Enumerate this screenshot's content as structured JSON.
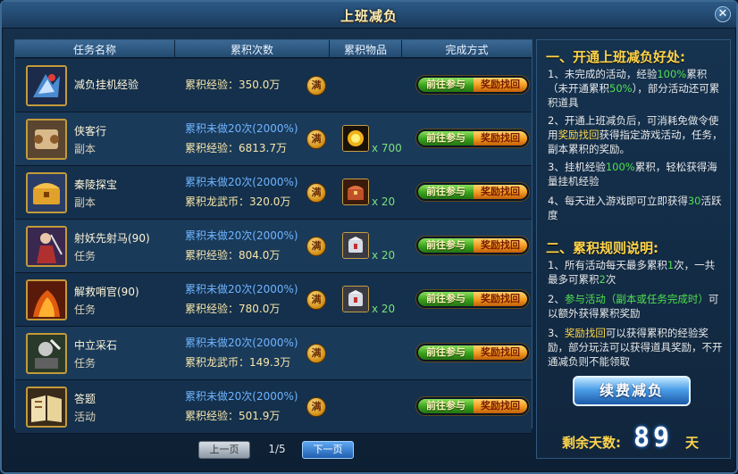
{
  "window": {
    "title": "上班减负"
  },
  "table": {
    "headers": [
      "任务名称",
      "累积次数",
      "累积物品",
      "完成方式"
    ],
    "go_label": "前往参与",
    "reward_label": "奖励找回",
    "full_label": "满",
    "rows": [
      {
        "name": "减负挂机经验",
        "type": "",
        "line1": "",
        "line2": "累积经验：350.0万",
        "item_icon": "",
        "item_count": ""
      },
      {
        "name": "侠客行",
        "type": "副本",
        "line1": "累积未做20次(2000%)",
        "line2": "累积经验：6813.7万",
        "item_icon": "gold-orb-icon",
        "item_count": "x 700"
      },
      {
        "name": "秦陵探宝",
        "type": "副本",
        "line1": "累积未做20次(2000%)",
        "line2": "累积龙武币：320.0万",
        "item_icon": "treasure-chest-icon",
        "item_count": "x 20"
      },
      {
        "name": "射妖先射马(90)",
        "type": "任务",
        "line1": "累积未做20次(2000%)",
        "line2": "累积经验：804.0万",
        "item_icon": "silver-box-icon",
        "item_count": "x 20"
      },
      {
        "name": "解救哨官(90)",
        "type": "任务",
        "line1": "累积未做20次(2000%)",
        "line2": "累积经验：780.0万",
        "item_icon": "silver-box-icon",
        "item_count": "x 20"
      },
      {
        "name": "中立采石",
        "type": "任务",
        "line1": "累积未做20次(2000%)",
        "line2": "累积龙武币：149.3万",
        "item_icon": "",
        "item_count": ""
      },
      {
        "name": "答题",
        "type": "活动",
        "line1": "累积未做20次(2000%)",
        "line2": "累积经验：501.9万",
        "item_icon": "",
        "item_count": ""
      }
    ]
  },
  "pager": {
    "prev": "上一页",
    "info": "1/5",
    "next": "下一页"
  },
  "info": {
    "sec1_title": "一、开通上班减负好处:",
    "sec1_p1a": "1、未完成的活动，经验",
    "sec1_p1b": "100%",
    "sec1_p1c": "累积（未开通累积",
    "sec1_p1d": "50%",
    "sec1_p1e": "），部分活动还可累积道具",
    "sec1_p2a": "2、开通上班减负后，可消耗免做令使用",
    "sec1_p2b": "奖励找回",
    "sec1_p2c": "获得指定游戏活动，任务，副本累积的奖励。",
    "sec1_p3a": "3、挂机经验",
    "sec1_p3b": "100%",
    "sec1_p3c": "累积，轻松获得海量挂机经验",
    "sec1_p4a": "4、每天进入游戏即可立即获得",
    "sec1_p4b": "30",
    "sec1_p4c": "活跃度",
    "sec2_title": "二、累积规则说明:",
    "sec2_p1a": "1、所有活动每天最多累积",
    "sec2_p1b": "1",
    "sec2_p1c": "次，一共最多可累积",
    "sec2_p1d": "2",
    "sec2_p1e": "次",
    "sec2_p2a": "2、",
    "sec2_p2b": "参与活动（副本或任务完成时）",
    "sec2_p2c": "可以额外获得累积奖励",
    "sec2_p3a": "3、",
    "sec2_p3b": "奖励找回",
    "sec2_p3c": "可以获得累积的经验奖励，部分玩法可以获得道具奖励，不开通减负则不能领取",
    "renew_label": "续费减负",
    "remain_label": "剩余天数:",
    "remain_days": "89",
    "remain_unit": "天"
  }
}
